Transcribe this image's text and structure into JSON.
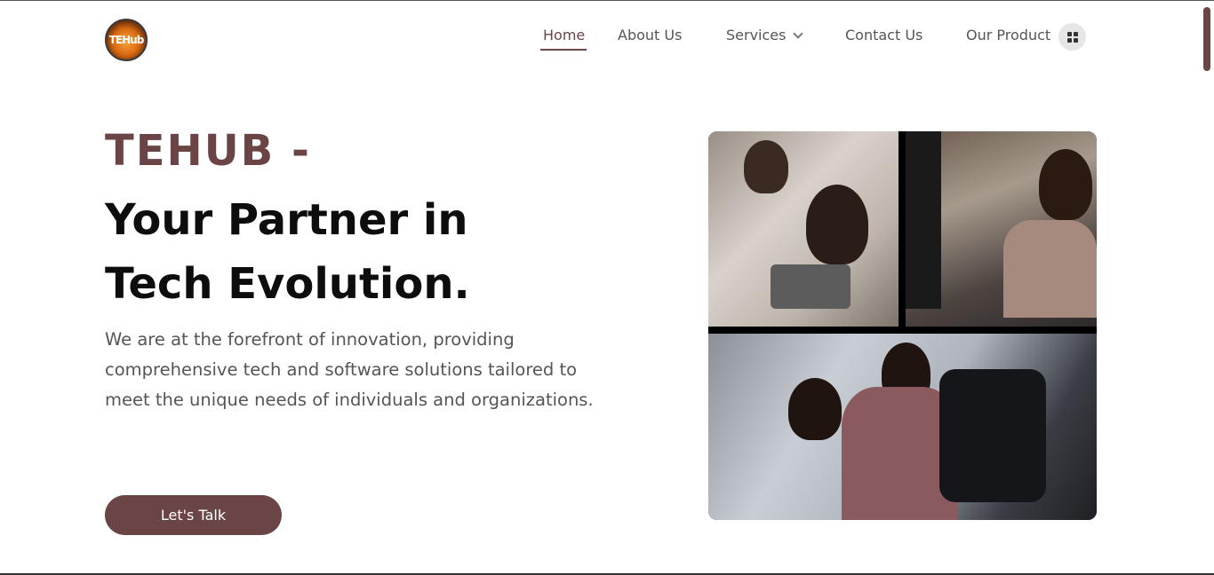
{
  "header": {
    "logo_text": "TEHub",
    "nav": {
      "home": "Home",
      "about": "About Us",
      "services": "Services",
      "contact": "Contact Us",
      "product": "Our Product"
    }
  },
  "hero": {
    "brand": "TEHUB -",
    "title_line1": "Your Partner in",
    "title_line2": "Tech Evolution.",
    "description": "We are at the forefront of innovation, providing comprehensive tech and software solutions tailored to meet the unique needs of individuals and organizations.",
    "cta_label": "Let's Talk"
  },
  "icons": {
    "services_dropdown": "chevron-down-icon",
    "product_menu": "grid-icon"
  },
  "colors": {
    "accent": "#6b4446",
    "text_dark": "#0d0d0d",
    "text_muted": "#555555"
  }
}
